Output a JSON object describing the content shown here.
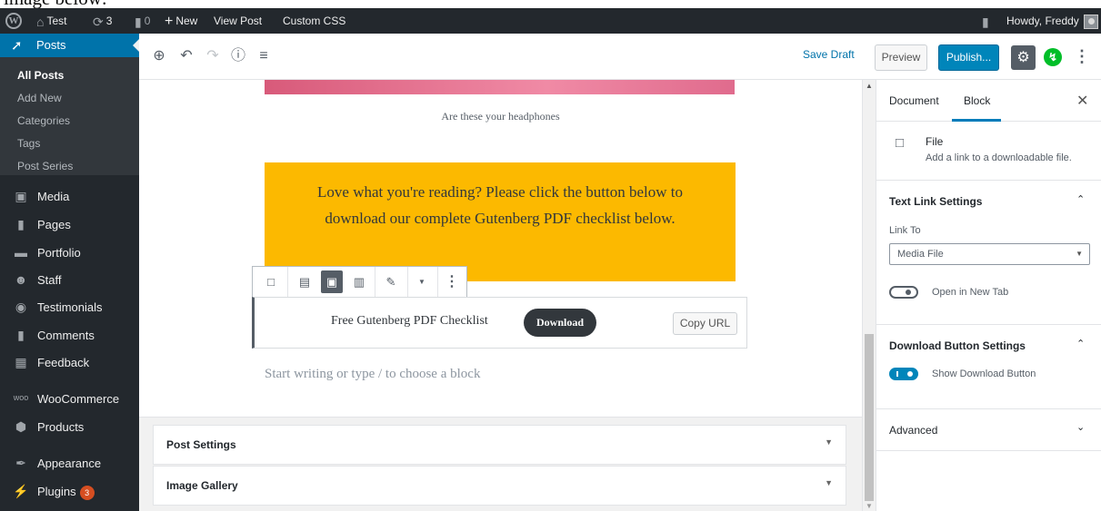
{
  "caption": "image below:",
  "admin_bar": {
    "site_name": "Test",
    "updates_count": "3",
    "comments_count": "0",
    "new_label": "New",
    "view_post": "View Post",
    "custom_css": "Custom CSS",
    "howdy": "Howdy, Freddy"
  },
  "sidebar": {
    "posts": "Posts",
    "submenu": [
      "All Posts",
      "Add New",
      "Categories",
      "Tags",
      "Post Series"
    ],
    "items": [
      "Media",
      "Pages",
      "Portfolio",
      "Staff",
      "Testimonials",
      "Comments",
      "Feedback",
      "WooCommerce",
      "Products",
      "Appearance",
      "Plugins"
    ],
    "plugins_badge": "3"
  },
  "header": {
    "save_draft": "Save Draft",
    "preview": "Preview",
    "publish": "Publish..."
  },
  "content": {
    "image_caption": "Are these your headphones",
    "cta_text": "Love what you're reading? Please click the button below to download our complete Gutenberg PDF checklist below.",
    "file_name": "Free Gutenberg PDF Checklist",
    "download_label": "Download",
    "copy_url": "Copy URL",
    "placeholder": "Start writing or type / to choose a block"
  },
  "meta_boxes": [
    "Post Settings",
    "Image Gallery"
  ],
  "settings_sidebar": {
    "tabs": [
      "Document",
      "Block"
    ],
    "active_tab": "Block",
    "block_name": "File",
    "block_description": "Add a link to a downloadable file.",
    "text_link_settings": "Text Link Settings",
    "link_to_label": "Link To",
    "link_to_value": "Media File",
    "open_new_tab": "Open in New Tab",
    "open_new_tab_on": false,
    "download_button_settings": "Download Button Settings",
    "show_download_button": "Show Download Button",
    "show_download_button_on": true,
    "advanced": "Advanced"
  },
  "colors": {
    "admin_dark": "#23282d",
    "accent_blue": "#0073aa",
    "publish_blue": "#0085ba",
    "cta_yellow": "#fcb900",
    "badge_orange": "#d54e21",
    "jetpack_green": "#00be28"
  },
  "icons": {
    "wordpress": "wordpress-logo-icon",
    "add_block": "plus-circle-icon",
    "undo": "undo-icon",
    "redo": "redo-icon",
    "info": "info-icon",
    "outline": "block-navigation-icon",
    "settings": "gear-icon",
    "jetpack": "jetpack-bolt-icon",
    "more": "vertical-ellipsis-icon"
  }
}
